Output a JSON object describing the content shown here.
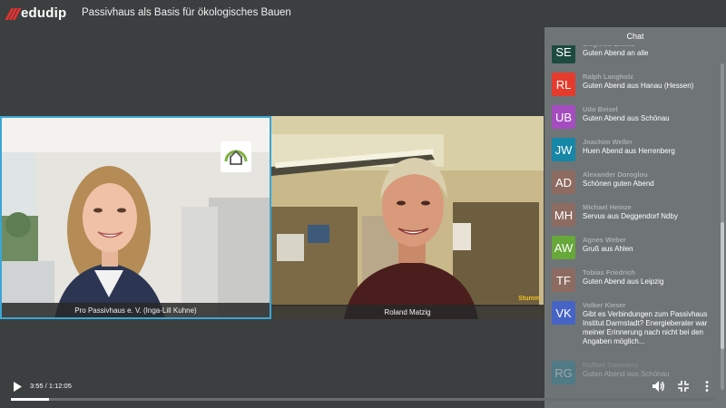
{
  "header": {
    "logo_text": "edudip",
    "title": "Passivhaus als Basis für ökologisches Bauen"
  },
  "videos": [
    {
      "label": "Pro Passivhaus e. V. (Inga-Lill Kuhne)",
      "active": true
    },
    {
      "label": "Roland Matzig",
      "overlay_tag": "Stumm",
      "active": false
    }
  ],
  "chat": {
    "title": "Chat",
    "messages": [
      {
        "initials": "SE",
        "name": "Siegfried Eiwilia",
        "text": "Guten Abend an alle",
        "color": "#1e4b3f"
      },
      {
        "initials": "RL",
        "name": "Ralph Langholz",
        "text": "Guten Abend aus Hanau (Hessen)",
        "color": "#e53b2c"
      },
      {
        "initials": "UB",
        "name": "Udo Beisel",
        "text": "Guten Abend aus Schönau",
        "color": "#a44cc0"
      },
      {
        "initials": "JW",
        "name": "Joachim Weller",
        "text": "Huen Abend aus Herrenberg",
        "color": "#1687a6"
      },
      {
        "initials": "AD",
        "name": "Alexander Doroglou",
        "text": "Schönen guten Abend",
        "color": "#8d6b61"
      },
      {
        "initials": "MH",
        "name": "Michael Heinze",
        "text": "Servus aus Deggendorf Ndby",
        "color": "#8d6b61"
      },
      {
        "initials": "AW",
        "name": "Agnes Weber",
        "text": "Gruß aus Ahlen",
        "color": "#66a83a"
      },
      {
        "initials": "TF",
        "name": "Tobias Friedrich",
        "text": "Guten Abend aus Leipzig",
        "color": "#8d6b61"
      },
      {
        "initials": "VK",
        "name": "Volker Kieser",
        "text": "Gibt es Verbindungen zum Passivhaus Institut Darmstadt? Energieberater war meiner Erinnerung nach nicht bei den Angaben möglich...",
        "color": "#4664c6"
      },
      {
        "initials": "RG",
        "name": "Raffael Guerriero",
        "text": "Guten Abend aus Schönau",
        "color": "#1687a6"
      }
    ]
  },
  "player": {
    "time": "3:55 / 1:12:05",
    "progress": 0.054,
    "icons": [
      "play-icon",
      "volume-icon",
      "fullscreen-exit-icon",
      "more-vert-icon"
    ]
  },
  "colors": {
    "brand_red": "#e8322f",
    "active_border": "#3aa6d6",
    "muted_tag": "#f0c020"
  }
}
